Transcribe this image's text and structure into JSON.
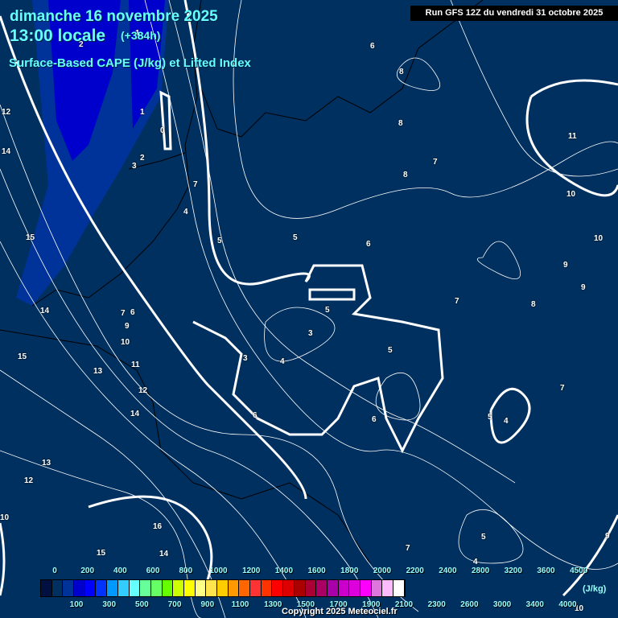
{
  "header": {
    "date": "dimanche 16 novembre 2025",
    "time": "13:00 locale",
    "lead": "(+384h)",
    "parameter": "Surface-Based CAPE (J/kg) et Lifted Index",
    "run": "Run GFS 12Z du vendredi 31 octobre 2025"
  },
  "lifted_index_labels": [
    "2",
    "1",
    "1",
    "0",
    "12",
    "14",
    "3",
    "2",
    "7",
    "4",
    "5",
    "15",
    "5",
    "6",
    "14",
    "7",
    "9",
    "10",
    "11",
    "15",
    "13",
    "12",
    "14",
    "13",
    "12",
    "10",
    "3",
    "3",
    "4",
    "5",
    "5",
    "6",
    "6",
    "5",
    "4",
    "16",
    "15",
    "14",
    "6",
    "6",
    "8",
    "8",
    "7",
    "8",
    "11",
    "10",
    "10",
    "9",
    "9",
    "7",
    "8",
    "7",
    "5",
    "4",
    "7",
    "9",
    "10"
  ],
  "legend": {
    "unit": "(J/kg)",
    "top_labels": [
      "0",
      "200",
      "400",
      "600",
      "800",
      "1000",
      "1200",
      "1400",
      "1600",
      "1800",
      "2000",
      "2200",
      "2400",
      "2800",
      "3200",
      "3600",
      "4500"
    ],
    "bottom_labels": [
      "100",
      "300",
      "500",
      "700",
      "900",
      "1100",
      "1300",
      "1500",
      "1700",
      "1900",
      "2100",
      "2300",
      "2600",
      "3000",
      "3400",
      "4000"
    ],
    "colors": [
      "#001040",
      "#00305f",
      "#003399",
      "#0000cc",
      "#0000ff",
      "#0033ff",
      "#0099ff",
      "#33ccff",
      "#66ffff",
      "#66ff99",
      "#66ff66",
      "#66ff00",
      "#ccff00",
      "#ffff00",
      "#ffff88",
      "#ffe44d",
      "#ffcc00",
      "#ff9900",
      "#ff6600",
      "#ff3333",
      "#ff3300",
      "#ff0000",
      "#dd0000",
      "#aa0000",
      "#aa0033",
      "#aa0066",
      "#aa00aa",
      "#cc00cc",
      "#dd00dd",
      "#ff00ff",
      "#dd77dd",
      "#ffbbff",
      "#ffffff"
    ]
  },
  "copyright": "Copyright 2025 Meteociel.fr"
}
